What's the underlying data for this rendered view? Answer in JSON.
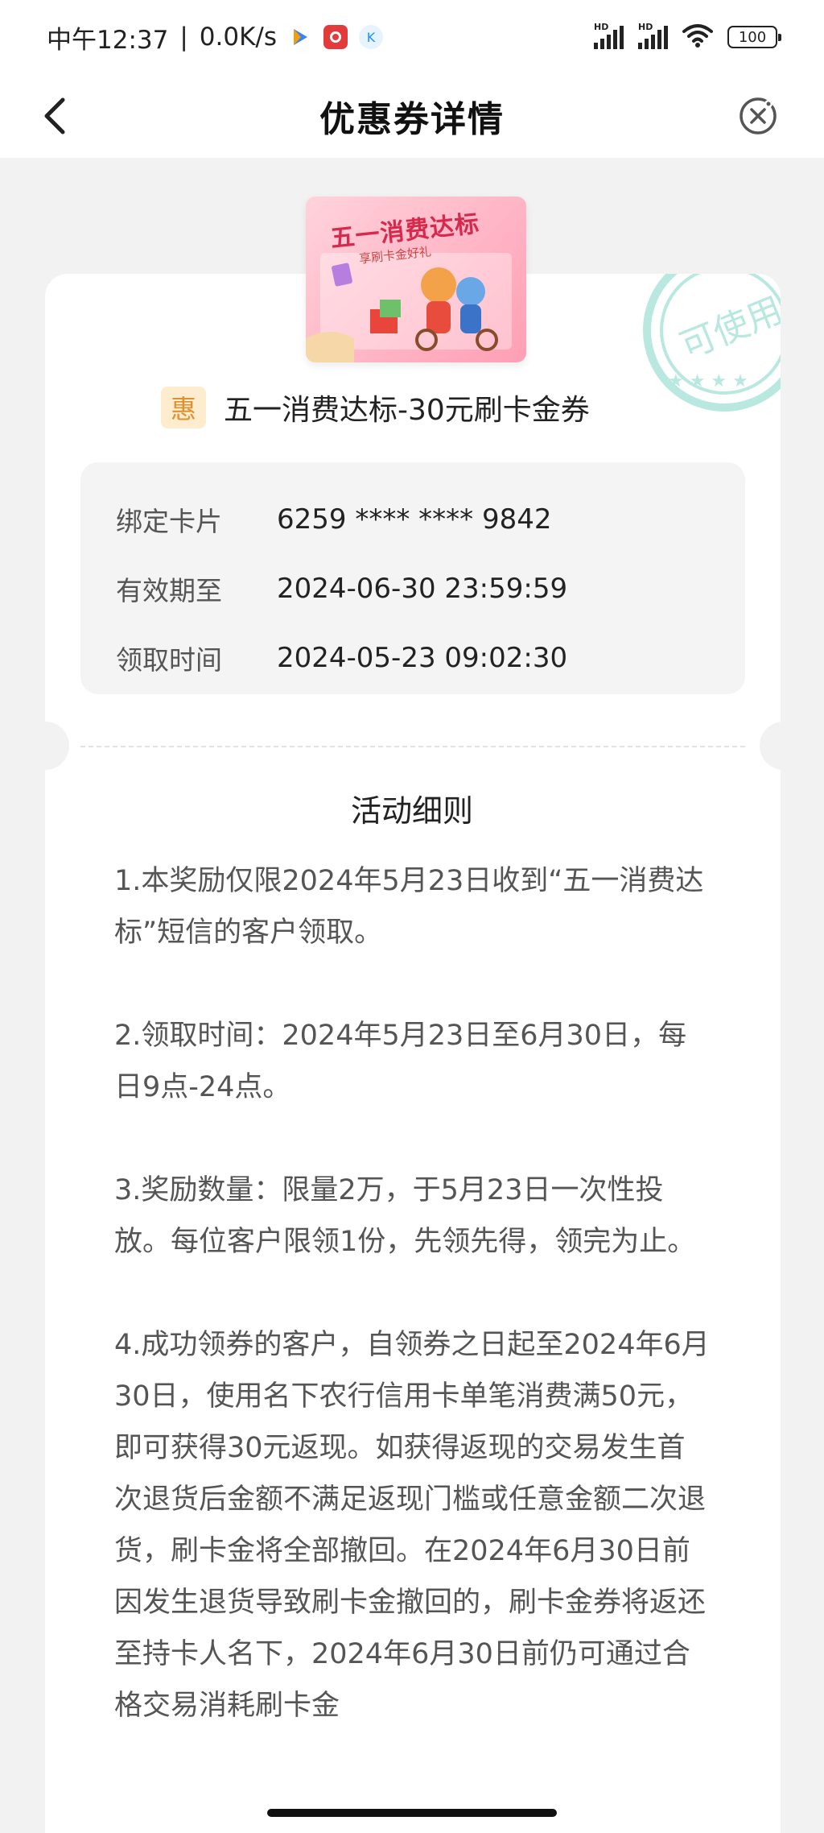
{
  "status_bar": {
    "time": "中午12:37",
    "net_speed": "0.0K/s",
    "signal_tag": "HD",
    "battery": "100",
    "colors": {
      "text": "#222222"
    }
  },
  "header": {
    "title": "优惠券详情",
    "back_icon": "chevron-left-icon",
    "close_icon": "close-circle-icon"
  },
  "coupon": {
    "banner_text": "五一消费达标",
    "banner_sub": "享刷卡金好礼",
    "stamp_text": "可使用",
    "badge": "惠",
    "title": "五一消费达标-30元刷卡金券",
    "details": [
      {
        "label": "绑定卡片",
        "value": "6259 **** **** 9842"
      },
      {
        "label": "有效期至",
        "value": "2024-06-30 23:59:59"
      },
      {
        "label": "领取时间",
        "value": "2024-05-23 09:02:30"
      }
    ],
    "colors": {
      "stamp": "#79d3c4",
      "badge_bg": "#fdeccd",
      "badge_fg": "#e0902c"
    }
  },
  "rules": {
    "title": "活动细则",
    "items": [
      "1.本奖励仅限2024年5月23日收到“五一消费达标”短信的客户领取。",
      "2.领取时间：2024年5月23日至6月30日，每日9点-24点。",
      "3.奖励数量：限量2万，于5月23日一次性投放。每位客户限领1份，先领先得，领完为止。",
      "4.成功领券的客户，自领券之日起至2024年6月30日，使用名下农行信用卡单笔消费满50元，即可获得30元返现。如获得返现的交易发生首次退货后金额不满足返现门槛或任意金额二次退货，刷卡金将全部撤回。在2024年6月30日前因发生退货导致刷卡金撤回的，刷卡金券将返还至持卡人名下，2024年6月30日前仍可通过合格交易消耗刷卡金"
    ]
  }
}
